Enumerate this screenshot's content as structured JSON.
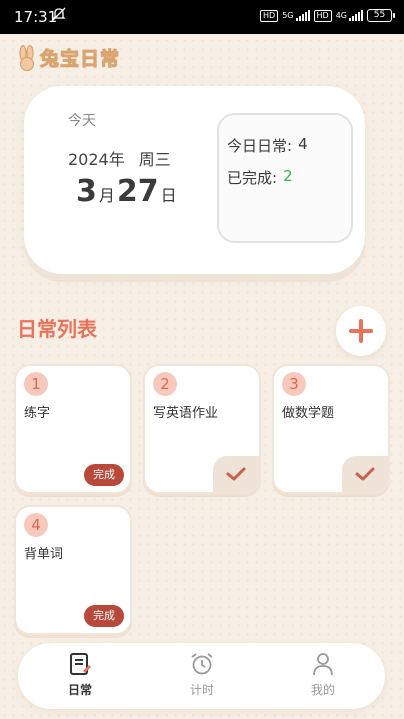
{
  "status_bar": {
    "time": "17:31",
    "mute_symbol": "ᗢ",
    "net1": "5G",
    "net2": "4G",
    "hd": "HD",
    "battery": "55"
  },
  "app": {
    "title": "兔宝日常"
  },
  "today_card": {
    "label": "今天",
    "year": "2024年",
    "weekday": "周三",
    "month": "3",
    "month_unit": "月",
    "day": "27",
    "day_unit": "日",
    "stats": {
      "daily_label": "今日日常:",
      "daily_count": "4",
      "done_label": "已完成:",
      "done_count": "2"
    }
  },
  "list": {
    "title": "日常列表",
    "tasks": [
      {
        "num": "1",
        "name": "练字",
        "done_label": "完成",
        "completed": false
      },
      {
        "num": "2",
        "name": "写英语作业",
        "completed": true
      },
      {
        "num": "3",
        "name": "做数学题",
        "completed": true
      },
      {
        "num": "4",
        "name": "背单词",
        "done_label": "完成",
        "completed": false
      }
    ]
  },
  "nav": {
    "items": [
      {
        "label": "日常",
        "icon": "note-icon",
        "active": true
      },
      {
        "label": "计时",
        "icon": "alarm-clock-icon",
        "active": false
      },
      {
        "label": "我的",
        "icon": "user-icon",
        "active": false
      }
    ]
  },
  "colors": {
    "accent": "#e8735a",
    "done_button": "#b9483b",
    "done_count": "#39b54a",
    "background": "#f7efe6"
  }
}
